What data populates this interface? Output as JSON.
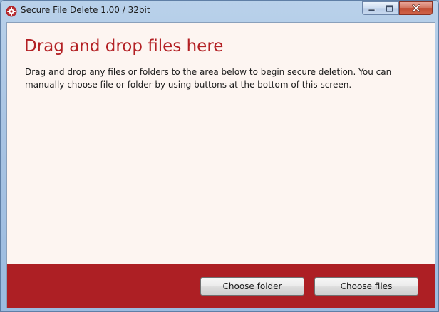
{
  "window": {
    "title": "Secure File Delete 1.00 / 32bit",
    "accent_color": "#ad1f24",
    "heading_color": "#b32024",
    "background_color": "#fdf5f1"
  },
  "titlebar_controls": {
    "minimize_icon": "minimize-icon",
    "maximize_icon": "maximize-icon",
    "close_icon": "close-icon"
  },
  "main": {
    "heading": "Drag and drop files here",
    "description": "Drag and drop any files or folders to the area below to begin secure deletion. You can manually choose file or folder by using buttons at the bottom of this screen."
  },
  "footer": {
    "choose_folder_label": "Choose folder",
    "choose_files_label": "Choose files"
  }
}
